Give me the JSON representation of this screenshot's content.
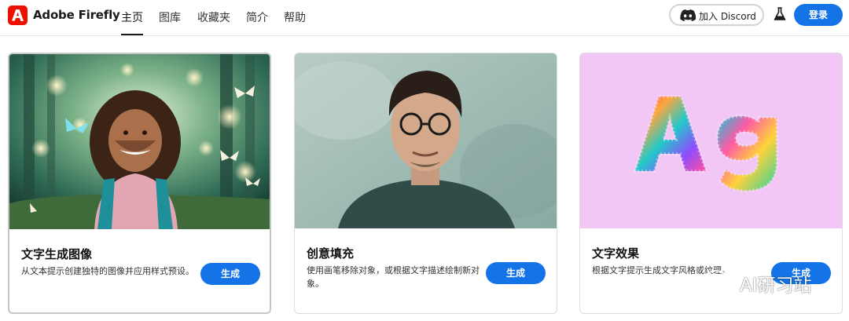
{
  "brand": {
    "name": "Adobe Firefly",
    "accent": "#eb1000"
  },
  "nav": {
    "items": [
      {
        "label": "主页",
        "active": true
      },
      {
        "label": "图库",
        "active": false
      },
      {
        "label": "收藏夹",
        "active": false
      },
      {
        "label": "简介",
        "active": false
      },
      {
        "label": "帮助",
        "active": false
      }
    ]
  },
  "header": {
    "discord_label": "加入 Discord",
    "login_label": "登录",
    "primary_color": "#1473e6"
  },
  "cards": [
    {
      "title": "文字生成图像",
      "description": "从文本提示创建独特的图像并应用样式预设。",
      "button_label": "生成",
      "image": "girl-with-butterflies-in-forest"
    },
    {
      "title": "创意填充",
      "description": "使用画笔移除对象，或根据文字描述绘制新对象。",
      "button_label": "生成",
      "image": "man-with-glasses-portrait"
    },
    {
      "title": "文字效果",
      "description": "根据文字提示生成文字风格或纹理。",
      "button_label": "生成",
      "image": "furry-rainbow-letters-Ag"
    }
  ],
  "watermark": {
    "text": "AI研习站"
  }
}
